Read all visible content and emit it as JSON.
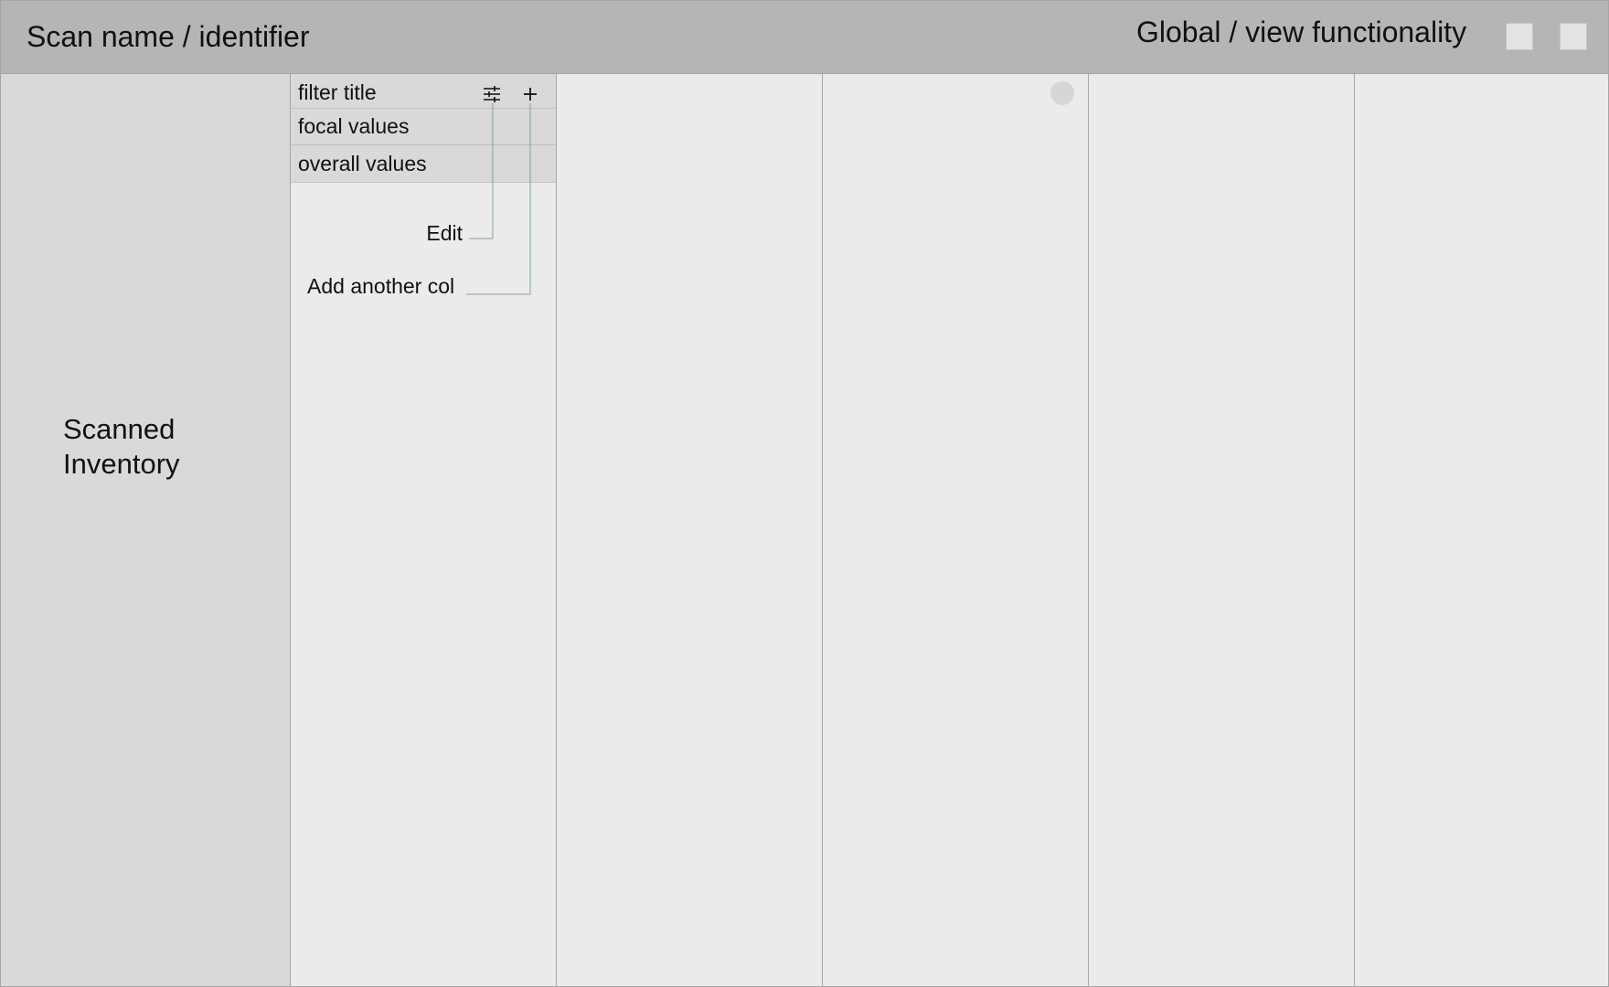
{
  "header": {
    "scan_title": "Scan name / identifier",
    "global_title": "Global / view functionality"
  },
  "sidebar": {
    "label": "Scanned Inventory"
  },
  "filter_column": {
    "title": "filter title",
    "focal_values": "focal values",
    "overall_values": "overall values",
    "edit_icon": "sliders-icon",
    "add_icon": "plus-icon"
  },
  "annotations": {
    "edit": "Edit",
    "add_column": "Add another col",
    "line_color": "#7fa39a"
  },
  "colors": {
    "header_bg": "#b5b5b5",
    "sidebar_bg": "#d9d9d9",
    "column_bg": "#ebebeb",
    "divider": "#a6a6a6"
  }
}
